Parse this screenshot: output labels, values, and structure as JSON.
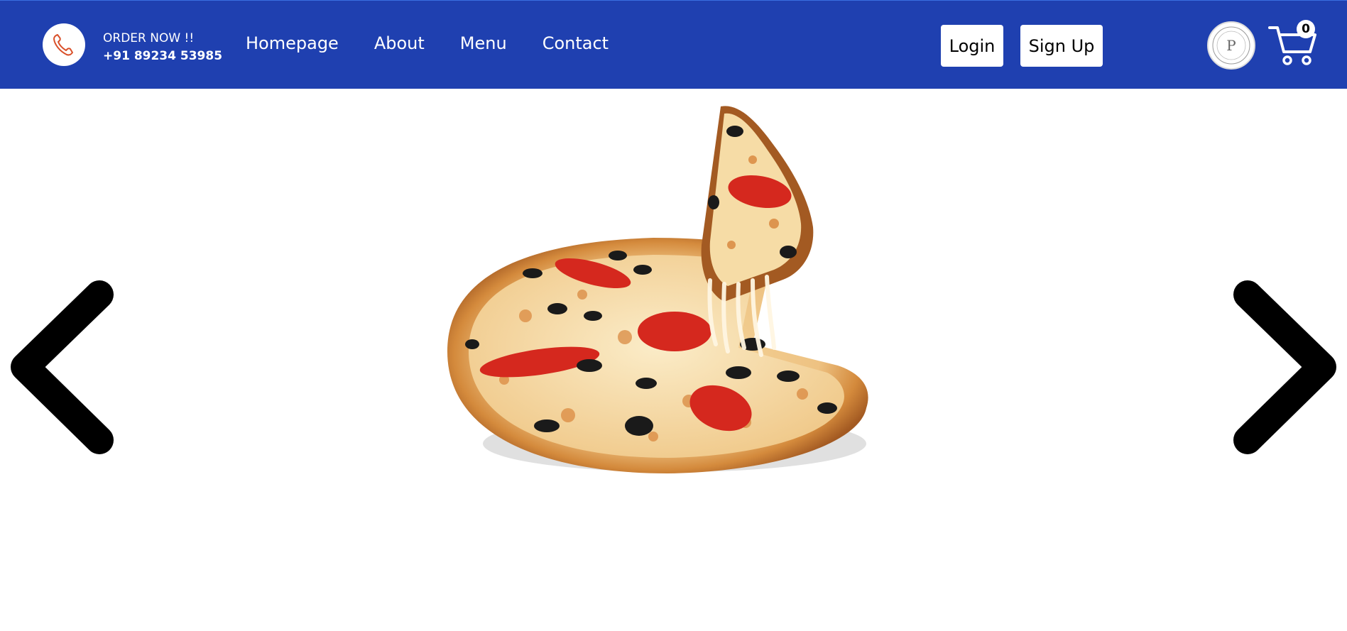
{
  "header": {
    "order_label": "ORDER NOW !!",
    "phone_number": "+91 89234 53985",
    "nav": [
      {
        "label": "Homepage"
      },
      {
        "label": "About"
      },
      {
        "label": "Menu"
      },
      {
        "label": "Contact"
      }
    ],
    "login_label": "Login",
    "signup_label": "Sign Up",
    "logo_letter": "P",
    "cart_count": "0",
    "colors": {
      "navbar": "#1f40b0",
      "phone_icon": "#d9502a"
    }
  },
  "icons": {
    "phone": "phone-icon",
    "logo": "brand-logo",
    "cart": "cart-icon",
    "prev": "chevron-left-icon",
    "next": "chevron-right-icon"
  },
  "carousel": {
    "slide_subject": "pizza"
  }
}
